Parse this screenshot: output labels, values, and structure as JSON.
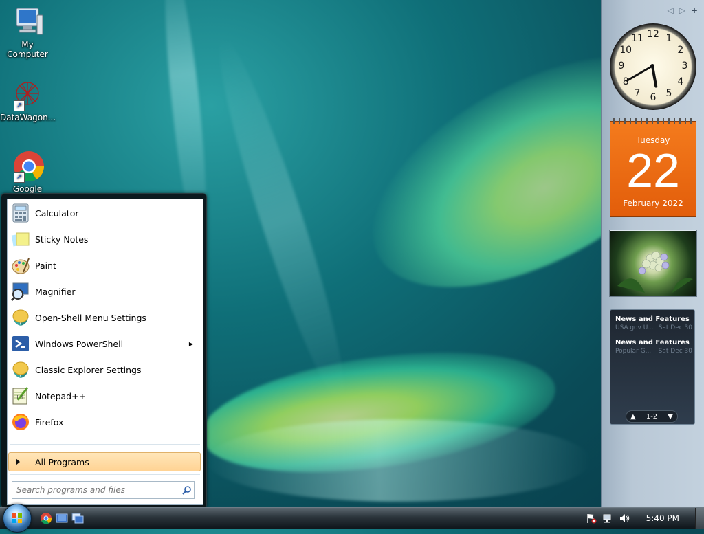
{
  "desktop": {
    "icons": [
      {
        "label": "My Computer",
        "icon": "computer-icon"
      },
      {
        "label": "DataWagon...",
        "icon": "datawagon-icon"
      },
      {
        "label": "Google",
        "icon": "chrome-icon"
      }
    ]
  },
  "start_menu": {
    "programs": [
      {
        "label": "Calculator",
        "icon": "calculator-icon"
      },
      {
        "label": "Sticky Notes",
        "icon": "sticky-notes-icon"
      },
      {
        "label": "Paint",
        "icon": "paint-icon"
      },
      {
        "label": "Magnifier",
        "icon": "magnifier-icon"
      },
      {
        "label": "Open-Shell Menu Settings",
        "icon": "open-shell-icon"
      },
      {
        "label": "Windows PowerShell",
        "icon": "powershell-icon",
        "has_submenu": true
      },
      {
        "label": "Classic Explorer Settings",
        "icon": "classic-explorer-icon"
      },
      {
        "label": "Notepad++",
        "icon": "notepadpp-icon"
      },
      {
        "label": "Firefox",
        "icon": "firefox-icon"
      }
    ],
    "all_programs_label": "All Programs",
    "search_placeholder": "Search programs and files"
  },
  "taskbar": {
    "quick_launch": [
      "chrome-icon",
      "show-desktop-icon",
      "switch-windows-icon"
    ],
    "tray_icons": [
      "action-center-flag-icon",
      "network-icon",
      "volume-icon"
    ],
    "time": "5:40 PM"
  },
  "sidebar": {
    "clock": {
      "hour": 5,
      "minute": 40
    },
    "clock_numbers": [
      "12",
      "1",
      "2",
      "3",
      "4",
      "5",
      "6",
      "7",
      "8",
      "9",
      "10",
      "11"
    ],
    "calendar": {
      "weekday": "Tuesday",
      "day": "22",
      "month_year": "February 2022"
    },
    "feeds": [
      {
        "title": "News and Features f...",
        "source": "USA.gov U...",
        "date": "Sat Dec 30"
      },
      {
        "title": "News and Features f...",
        "source": "Popular G...",
        "date": "Sat Dec 30"
      }
    ],
    "feed_page": "1-2"
  },
  "colors": {
    "calendar_orange": "#f47b1d",
    "all_programs_highlight": "#ffd394",
    "sidebar_bg": "#b9c8d6"
  }
}
